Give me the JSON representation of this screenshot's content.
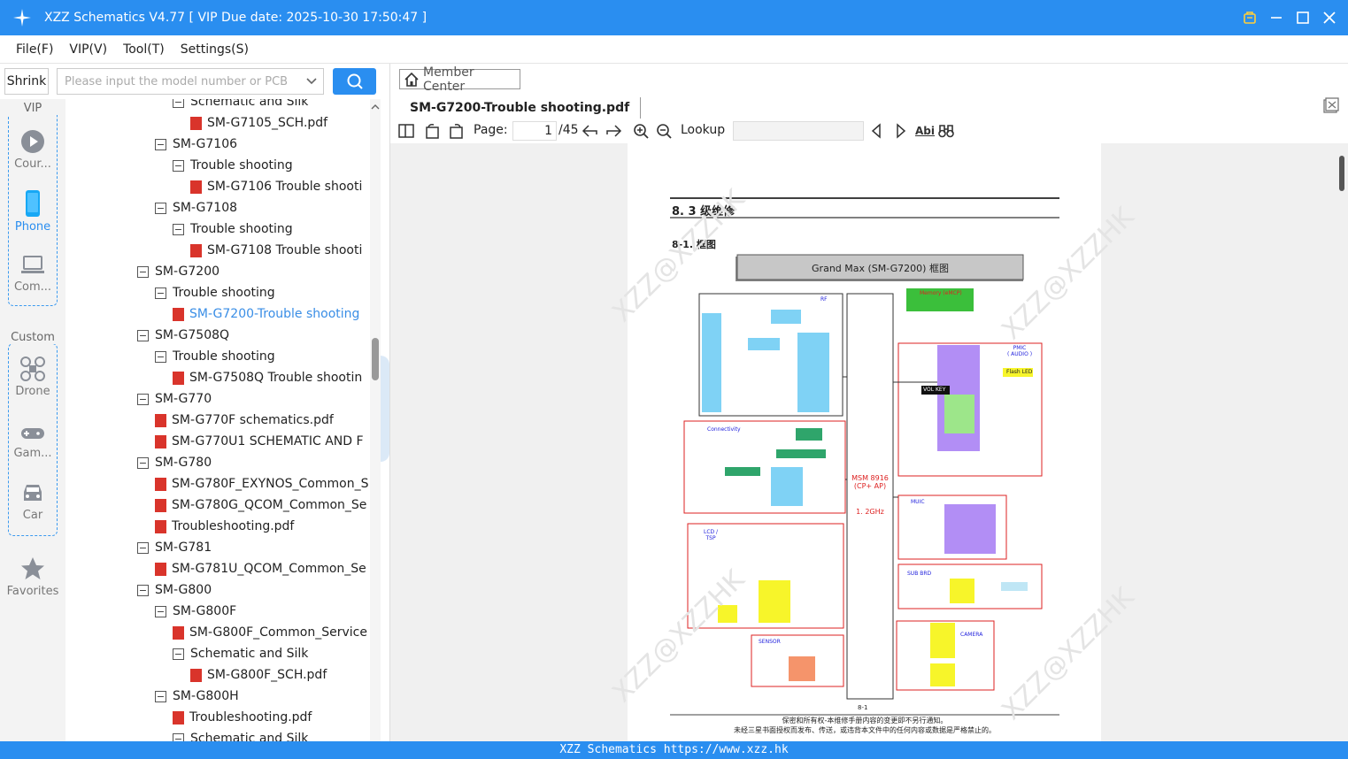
{
  "app": {
    "title": "XZZ Schematics V4.77 [ VIP Due date: 2025-10-30 17:50:47 ]"
  },
  "menu": [
    "File(F)",
    "VIP(V)",
    "Tool(T)",
    "Settings(S)"
  ],
  "search": {
    "shrink_label": "Shrink",
    "placeholder": "Please input the model number or PCB"
  },
  "sidebar": {
    "vip_label": "VIP",
    "custom_label": "Custom",
    "items": [
      {
        "label": "Cour...",
        "icon": "play-icon"
      },
      {
        "label": "Phone",
        "icon": "phone-icon",
        "active": true
      },
      {
        "label": "Com...",
        "icon": "laptop-icon"
      },
      {
        "label": "Drone",
        "icon": "drone-icon"
      },
      {
        "label": "Gam...",
        "icon": "gamepad-icon"
      },
      {
        "label": "Car",
        "icon": "car-icon"
      },
      {
        "label": "Favorites",
        "icon": "star-icon"
      }
    ]
  },
  "tree": [
    {
      "label": "Schematic and Silk",
      "level": 2,
      "type": "folder"
    },
    {
      "label": "SM-G7105_SCH.pdf",
      "level": 3,
      "type": "pdf"
    },
    {
      "label": "SM-G7106",
      "level": 1,
      "type": "folder"
    },
    {
      "label": "Trouble shooting",
      "level": 2,
      "type": "folder"
    },
    {
      "label": "SM-G7106 Trouble shooti",
      "level": 3,
      "type": "pdf"
    },
    {
      "label": "SM-G7108",
      "level": 1,
      "type": "folder"
    },
    {
      "label": "Trouble shooting",
      "level": 2,
      "type": "folder"
    },
    {
      "label": "SM-G7108 Trouble shooti",
      "level": 3,
      "type": "pdf"
    },
    {
      "label": "SM-G7200",
      "level": 0,
      "type": "folder"
    },
    {
      "label": "Trouble shooting",
      "level": 1,
      "type": "folder"
    },
    {
      "label": "SM-G7200-Trouble shooting",
      "level": 2,
      "type": "pdf",
      "selected": true
    },
    {
      "label": "SM-G7508Q",
      "level": 0,
      "type": "folder"
    },
    {
      "label": "Trouble shooting",
      "level": 1,
      "type": "folder"
    },
    {
      "label": "SM-G7508Q Trouble shootin",
      "level": 2,
      "type": "pdf"
    },
    {
      "label": "SM-G770",
      "level": 0,
      "type": "folder"
    },
    {
      "label": "SM-G770F schematics.pdf",
      "level": 1,
      "type": "pdf"
    },
    {
      "label": "SM-G770U1 SCHEMATIC AND F",
      "level": 1,
      "type": "pdf"
    },
    {
      "label": "SM-G780",
      "level": 0,
      "type": "folder"
    },
    {
      "label": "SM-G780F_EXYNOS_Common_S",
      "level": 1,
      "type": "pdf"
    },
    {
      "label": "SM-G780G_QCOM_Common_Se",
      "level": 1,
      "type": "pdf"
    },
    {
      "label": "Troubleshooting.pdf",
      "level": 1,
      "type": "pdf"
    },
    {
      "label": "SM-G781",
      "level": 0,
      "type": "folder"
    },
    {
      "label": "SM-G781U_QCOM_Common_Se",
      "level": 1,
      "type": "pdf"
    },
    {
      "label": "SM-G800",
      "level": 0,
      "type": "folder"
    },
    {
      "label": "SM-G800F",
      "level": 1,
      "type": "folder"
    },
    {
      "label": "SM-G800F_Common_Service",
      "level": 2,
      "type": "pdf"
    },
    {
      "label": "Schematic and Silk",
      "level": 2,
      "type": "folder"
    },
    {
      "label": "SM-G800F_SCH.pdf",
      "level": 3,
      "type": "pdf"
    },
    {
      "label": "SM-G800H",
      "level": 1,
      "type": "folder"
    },
    {
      "label": "Troubleshooting.pdf",
      "level": 2,
      "type": "pdf"
    },
    {
      "label": "Schematic and Silk",
      "level": 2,
      "type": "folder"
    }
  ],
  "viewer": {
    "member_center": "Member Center",
    "doc_tab": "SM-G7200-Trouble shooting.pdf",
    "page_label": "Page:",
    "page_current": "1",
    "page_total": "/45",
    "lookup_label": "Lookup",
    "abi_label": "Abi"
  },
  "document": {
    "section_title": "8. 3 级维修",
    "subsection": "8-1.  框图",
    "diagram_title": "Grand Max (SM-G7200)  框图",
    "blocks": {
      "rf": "RF",
      "connectivity": "Connectivity",
      "msm": "MSM 8916\n(CP+ AP)",
      "msm_freq": "1. 2GHz",
      "pmic": "PMIC\n( AUDIO )",
      "muic": "MUIC",
      "lcd": "LCD /\nTSP",
      "sub_brd": "SUB BRD",
      "sensor": "SENSOR",
      "camera": "CAMERA",
      "vol_key": "VOL KEY",
      "flash_led": "Flash LED",
      "memory": "Memory (eMCP)"
    },
    "page_number": "8-1",
    "footer_line1": "保密和所有权-本维修手册内容的变更即不另行通知。",
    "footer_line2": "未经三星书面授权而发布、传送，或违背本文件中的任何内容或数据是严格禁止的。",
    "watermark": "XZZ@XZZHK"
  },
  "status": {
    "text": "XZZ Schematics https://www.xzz.hk"
  },
  "colors": {
    "accent": "#2a8ef0",
    "selected_text": "#3a8ee6",
    "pdf_icon": "#d9342b"
  }
}
